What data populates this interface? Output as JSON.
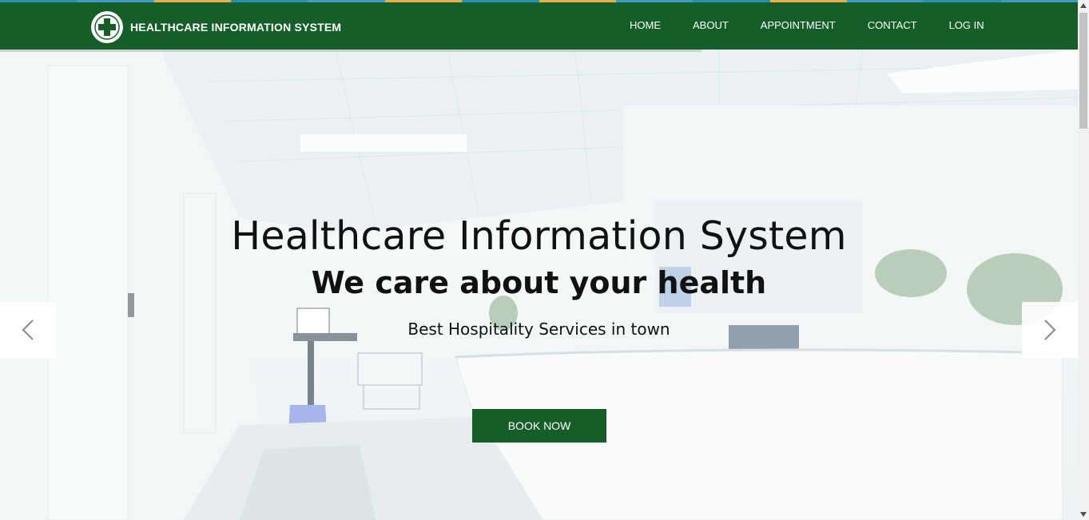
{
  "colors": {
    "brand_green": "#155e2a",
    "strip": [
      "#2a8fb5",
      "#3c9ac4",
      "#e3b04b",
      "#2a8fb5",
      "#3c9ac4",
      "#e3b04b",
      "#2a8fb5",
      "#e3b04b",
      "#3c9ac4",
      "#2a8fb5",
      "#e3b04b",
      "#3c9ac4",
      "#2a8fb5",
      "#3c9ac4"
    ]
  },
  "header": {
    "brand_name": "HEALTHCARE INFORMATION SYSTEM",
    "logo_icon": "medical-cross-icon",
    "nav": [
      "HOME",
      "ABOUT",
      "APPOINTMENT",
      "CONTACT",
      "LOG IN"
    ]
  },
  "hero": {
    "title": "Healthcare Information System",
    "subtitle": "We care about your health",
    "tagline": "Best Hospitality Services in town",
    "button_label": "BOOK NOW",
    "prev_icon": "chevron-left-icon",
    "next_icon": "chevron-right-icon"
  }
}
